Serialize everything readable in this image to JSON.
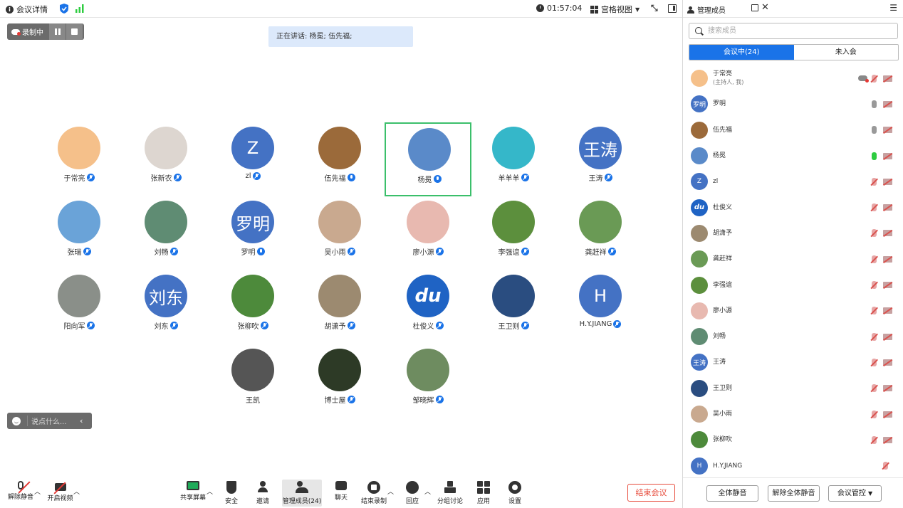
{
  "topbar": {
    "title": "会议详情",
    "timer": "01:57:04",
    "view": "宫格视图"
  },
  "recording": {
    "label": "录制中"
  },
  "speaking": "正在讲话: 杨冕; 伍先福;",
  "tiles": [
    {
      "name": "于常亮",
      "initial": "",
      "color": "#f5c08a",
      "mic": "muted"
    },
    {
      "name": "张新农",
      "initial": "",
      "color": "#ddd6d0",
      "mic": "muted"
    },
    {
      "name": "zl",
      "initial": "Z",
      "color": "#4472c4",
      "mic": "muted"
    },
    {
      "name": "伍先福",
      "initial": "",
      "color": "#9b6a3a",
      "mic": "on"
    },
    {
      "name": "杨冕",
      "initial": "",
      "color": "#5a8ac9",
      "mic": "on"
    },
    {
      "name": "羊羊羊",
      "initial": "",
      "color": "#35b7c9",
      "mic": "muted"
    },
    {
      "name": "王涛",
      "initial": "王涛",
      "color": "#4472c4",
      "mic": "muted"
    },
    {
      "name": "张瑞",
      "initial": "",
      "color": "#6aa3d8",
      "mic": "muted"
    },
    {
      "name": "刘畅",
      "initial": "",
      "color": "#5f8c73",
      "mic": "muted"
    },
    {
      "name": "罗明",
      "initial": "罗明",
      "color": "#4472c4",
      "mic": "on"
    },
    {
      "name": "吴小雨",
      "initial": "",
      "color": "#c9a98f",
      "mic": "muted"
    },
    {
      "name": "廖小源",
      "initial": "",
      "color": "#e8b9b0",
      "mic": "muted"
    },
    {
      "name": "李强谊",
      "initial": "",
      "color": "#5c8f3d",
      "mic": "muted"
    },
    {
      "name": "龚赶祥",
      "initial": "",
      "color": "#6a9a55",
      "mic": "muted"
    },
    {
      "name": "阳向军",
      "initial": "",
      "color": "#8a8f89",
      "mic": "muted"
    },
    {
      "name": "刘东",
      "initial": "刘东",
      "color": "#4472c4",
      "mic": "muted"
    },
    {
      "name": "张柳吹",
      "initial": "",
      "color": "#4d8a3b",
      "mic": "muted"
    },
    {
      "name": "胡潇予",
      "initial": "",
      "color": "#9c8a70",
      "mic": "muted"
    },
    {
      "name": "杜俊义",
      "initial": "du",
      "color": "#1f63c4",
      "mic": "muted"
    },
    {
      "name": "王卫则",
      "initial": "",
      "color": "#2a4d80",
      "mic": "muted"
    },
    {
      "name": "H.Y.JIANG",
      "initial": "H",
      "color": "#4472c4",
      "mic": "muted"
    },
    {
      "name": "王凯",
      "initial": "",
      "color": "#555555",
      "mic": "none"
    },
    {
      "name": "博士屋",
      "initial": "",
      "color": "#2d3a26",
      "mic": "muted"
    },
    {
      "name": "邹晓辉",
      "initial": "",
      "color": "#6e8c60",
      "mic": "muted"
    }
  ],
  "chat": {
    "placeholder": "说点什么..."
  },
  "toolbar": {
    "unmute": "解除静音",
    "video": "开启视频",
    "share": "共享屏幕",
    "security": "安全",
    "invite": "邀请",
    "members": "管理成员(24)",
    "chat": "聊天",
    "stoprec": "结束录制",
    "react": "回应",
    "breakout": "分组讨论",
    "apps": "应用",
    "settings": "设置",
    "end": "结束会议"
  },
  "sidebar": {
    "title": "管理成员",
    "search_placeholder": "搜索成员",
    "tab_in": "会议中(24)",
    "tab_out": "未入会",
    "participants": [
      {
        "name": "于常亮",
        "sub": "(主持人, 我)",
        "initial": "",
        "color": "#f5c08a",
        "mic": "muted",
        "cloud": true
      },
      {
        "name": "罗明",
        "sub": "",
        "initial": "罗明",
        "color": "#4472c4",
        "mic": "on"
      },
      {
        "name": "伍先福",
        "sub": "",
        "initial": "",
        "color": "#9b6a3a",
        "mic": "on"
      },
      {
        "name": "杨冕",
        "sub": "",
        "initial": "",
        "color": "#5a8ac9",
        "mic": "talk"
      },
      {
        "name": "zl",
        "sub": "",
        "initial": "Z",
        "color": "#4472c4",
        "mic": "muted"
      },
      {
        "name": "杜俊义",
        "sub": "",
        "initial": "du",
        "color": "#1f63c4",
        "mic": "muted"
      },
      {
        "name": "胡潇予",
        "sub": "",
        "initial": "",
        "color": "#9c8a70",
        "mic": "muted"
      },
      {
        "name": "龚赶祥",
        "sub": "",
        "initial": "",
        "color": "#6a9a55",
        "mic": "muted"
      },
      {
        "name": "李强谊",
        "sub": "",
        "initial": "",
        "color": "#5c8f3d",
        "mic": "muted"
      },
      {
        "name": "廖小源",
        "sub": "",
        "initial": "",
        "color": "#e8b9b0",
        "mic": "muted"
      },
      {
        "name": "刘畅",
        "sub": "",
        "initial": "",
        "color": "#5f8c73",
        "mic": "muted"
      },
      {
        "name": "王涛",
        "sub": "",
        "initial": "王涛",
        "color": "#4472c4",
        "mic": "muted"
      },
      {
        "name": "王卫则",
        "sub": "",
        "initial": "",
        "color": "#2a4d80",
        "mic": "muted"
      },
      {
        "name": "吴小雨",
        "sub": "",
        "initial": "",
        "color": "#c9a98f",
        "mic": "muted"
      },
      {
        "name": "张柳吹",
        "sub": "",
        "initial": "",
        "color": "#4d8a3b",
        "mic": "muted"
      },
      {
        "name": "H.Y.JIANG",
        "sub": "",
        "initial": "H",
        "color": "#4472c4",
        "mic": "muted",
        "nocam": true
      }
    ],
    "mute_all": "全体静音",
    "unmute_all": "解除全体静音",
    "control": "会议管控"
  }
}
